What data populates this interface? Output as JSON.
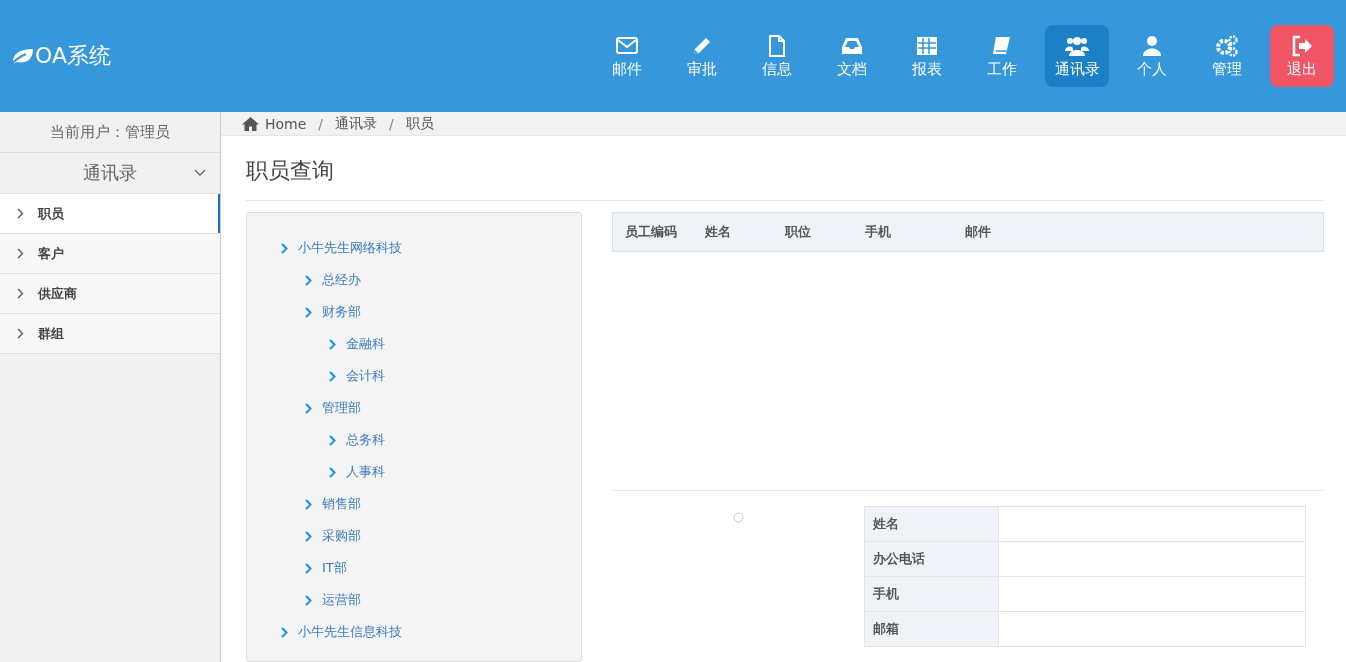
{
  "header": {
    "logo": "OA系统",
    "nav": [
      {
        "label": "邮件",
        "kind": "nav",
        "selected": false
      },
      {
        "label": "审批",
        "kind": "nav",
        "selected": false
      },
      {
        "label": "信息",
        "kind": "nav",
        "selected": false
      },
      {
        "label": "文档",
        "kind": "nav",
        "selected": false
      },
      {
        "label": "报表",
        "kind": "nav",
        "selected": false
      },
      {
        "label": "工作",
        "kind": "nav",
        "selected": false
      },
      {
        "label": "通讯录",
        "kind": "nav",
        "selected": true
      },
      {
        "label": "个人",
        "kind": "nav",
        "selected": false
      },
      {
        "label": "管理",
        "kind": "nav",
        "selected": false
      },
      {
        "label": "退出",
        "kind": "logout"
      }
    ]
  },
  "sidebar": {
    "current_user": "当前用户：管理员",
    "section": {
      "title": "通讯录",
      "expanded": true
    },
    "items": [
      {
        "label": "职员",
        "selected": true
      },
      {
        "label": "客户",
        "selected": false
      },
      {
        "label": "供应商",
        "selected": false
      },
      {
        "label": "群组",
        "selected": false
      }
    ]
  },
  "breadcrumb": {
    "separator": "/",
    "items": [
      "Home",
      "通讯录",
      "职员"
    ]
  },
  "page_title": "职员查询",
  "tree": [
    {
      "label": "小牛先生网络科技",
      "children": [
        {
          "label": "总经办"
        },
        {
          "label": "财务部",
          "children": [
            {
              "label": "金融科"
            },
            {
              "label": "会计科"
            }
          ]
        },
        {
          "label": "管理部",
          "children": [
            {
              "label": "总务科"
            },
            {
              "label": "人事科"
            }
          ]
        },
        {
          "label": "销售部"
        },
        {
          "label": "采购部"
        },
        {
          "label": "IT部"
        },
        {
          "label": "运营部"
        }
      ]
    },
    {
      "label": "小牛先生信息科技"
    }
  ],
  "table": {
    "columns": [
      "员工编码",
      "姓名",
      "职位",
      "手机",
      "邮件"
    ]
  },
  "detail": {
    "fields": [
      "姓名",
      "办公电话",
      "手机",
      "邮箱"
    ]
  }
}
